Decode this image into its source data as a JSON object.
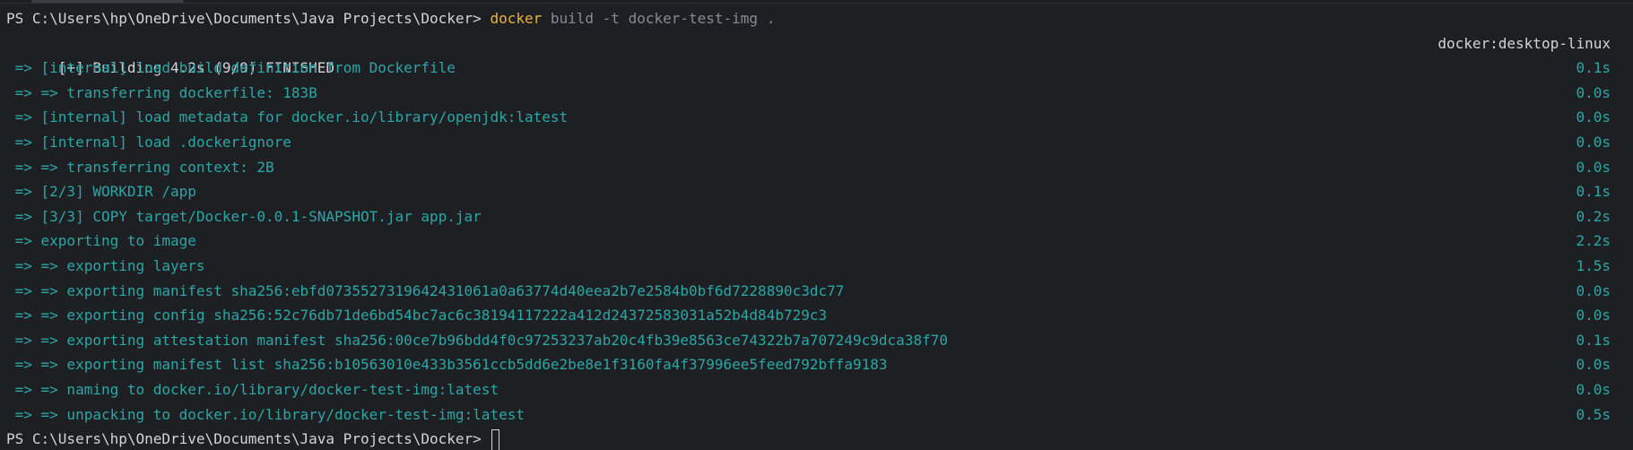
{
  "terminal": {
    "prompt": "PS C:\\Users\\hp\\OneDrive\\Documents\\Java Projects\\Docker> ",
    "command": {
      "name": "docker",
      "args": " build -t docker-test-img ."
    },
    "header": {
      "text": "[+] Building 4.2s (9/9) FINISHED",
      "context": "docker:desktop-linux"
    },
    "steps": [
      {
        "text": " => [internal] load build definition from Dockerfile",
        "time": "0.1s"
      },
      {
        "text": " => => transferring dockerfile: 183B",
        "time": "0.0s"
      },
      {
        "text": " => [internal] load metadata for docker.io/library/openjdk:latest",
        "time": "0.0s"
      },
      {
        "text": " => [internal] load .dockerignore",
        "time": "0.0s"
      },
      {
        "text": " => => transferring context: 2B",
        "time": "0.0s"
      },
      {
        "text": " => [2/3] WORKDIR /app",
        "time": "0.1s"
      },
      {
        "text": " => [3/3] COPY target/Docker-0.0.1-SNAPSHOT.jar app.jar",
        "time": "0.2s"
      },
      {
        "text": " => exporting to image",
        "time": "2.2s"
      },
      {
        "text": " => => exporting layers",
        "time": "1.5s"
      },
      {
        "text": " => => exporting manifest sha256:ebfd0735527319642431061a0a63774d40eea2b7e2584b0bf6d7228890c3dc77",
        "time": "0.0s"
      },
      {
        "text": " => => exporting config sha256:52c76db71de6bd54bc7ac6c38194117222a412d24372583031a52b4d84b729c3",
        "time": "0.0s"
      },
      {
        "text": " => => exporting attestation manifest sha256:00ce7b96bdd4f0c97253237ab20c4fb39e8563ce74322b7a707249c9dca38f70",
        "time": "0.1s"
      },
      {
        "text": " => => exporting manifest list sha256:b10563010e433b3561ccb5dd6e2be8e1f3160fa4f37996ee5feed792bffa9183",
        "time": "0.0s"
      },
      {
        "text": " => => naming to docker.io/library/docker-test-img:latest",
        "time": "0.0s"
      },
      {
        "text": " => => unpacking to docker.io/library/docker-test-img:latest",
        "time": "0.5s"
      }
    ],
    "final_prompt": "PS C:\\Users\\hp\\OneDrive\\Documents\\Java Projects\\Docker> "
  }
}
